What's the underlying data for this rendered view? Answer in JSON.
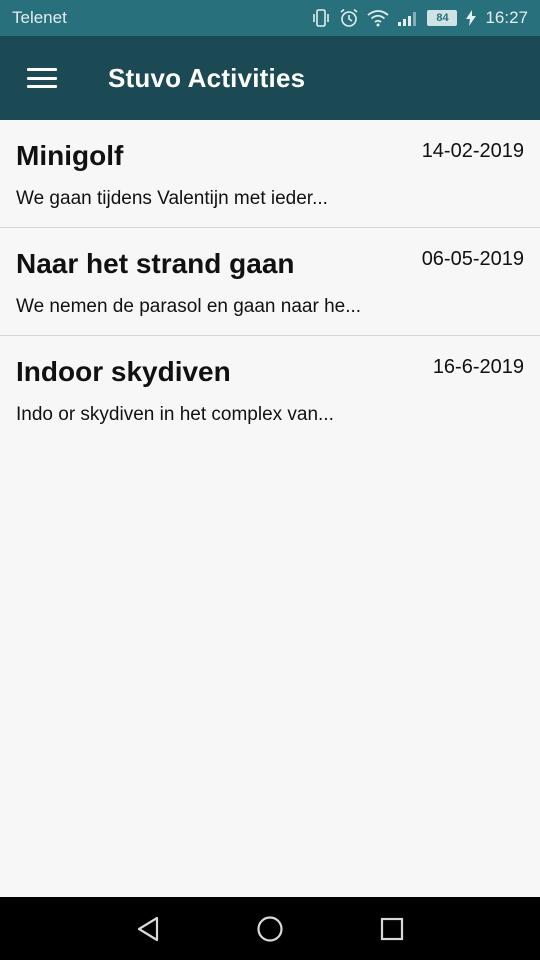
{
  "status_bar": {
    "carrier": "Telenet",
    "battery": "84",
    "time": "16:27",
    "icons": [
      "vibrate-icon",
      "alarm-icon",
      "wifi-icon",
      "signal-icon",
      "battery-icon",
      "charging-icon"
    ]
  },
  "app_bar": {
    "title": "Stuvo Activities",
    "menu_icon": "hamburger-menu-icon"
  },
  "activities": [
    {
      "title": "Minigolf",
      "date": "14-02-2019",
      "description": "We gaan tijdens Valentijn met ieder..."
    },
    {
      "title": "Naar het strand gaan",
      "date": "06-05-2019",
      "description": "We nemen de parasol en gaan naar he..."
    },
    {
      "title": "Indoor skydiven",
      "date": "16-6-2019",
      "description": "Indo or skydiven in het complex van..."
    }
  ],
  "nav_bar": {
    "icons": [
      "back-icon",
      "home-icon",
      "recents-icon"
    ]
  },
  "colors": {
    "status_bar": "#27707c",
    "app_bar": "#1b4a55",
    "background": "#f7f7f7",
    "nav_bar": "#000000"
  }
}
